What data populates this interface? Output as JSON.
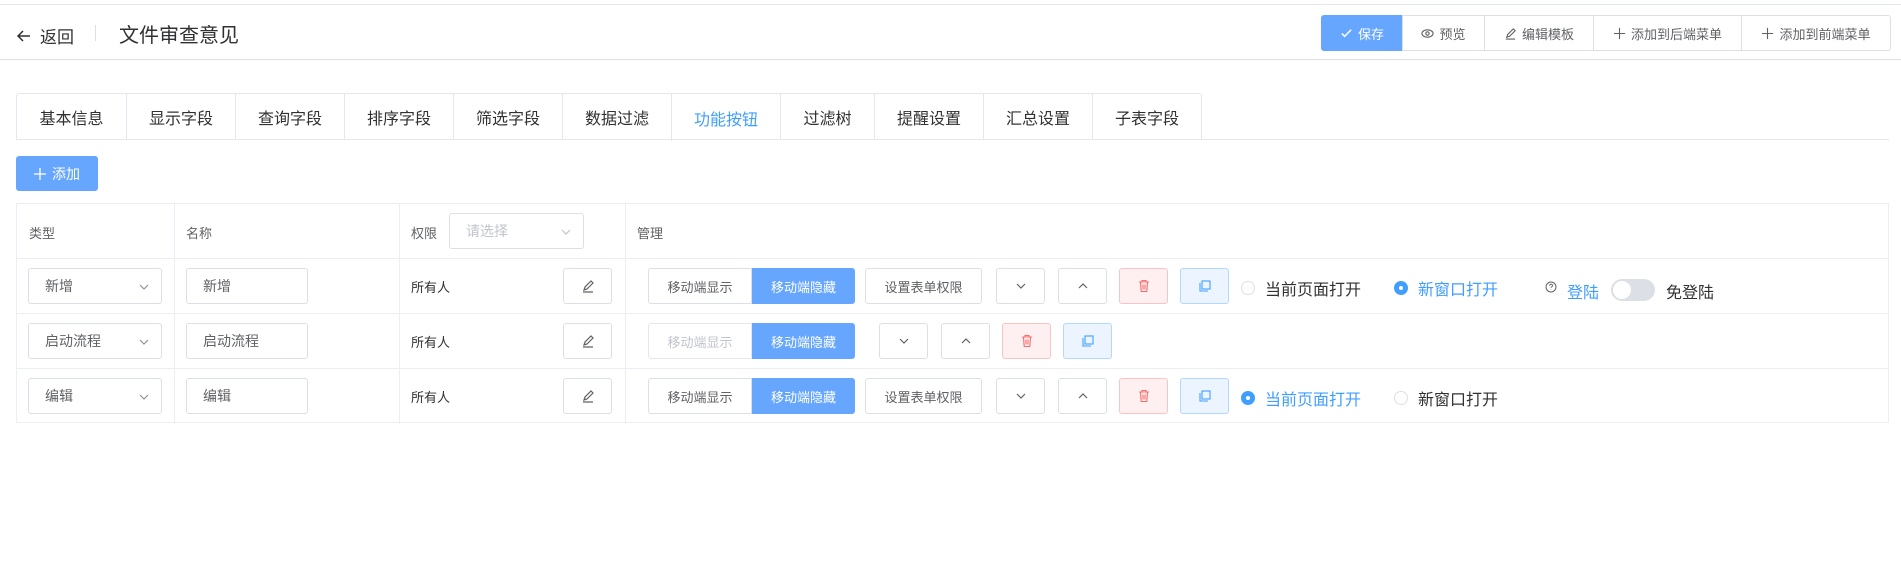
{
  "header": {
    "back_label": "返回",
    "title": "文件审查意见",
    "actions": [
      {
        "label": "保存",
        "icon": "check-icon"
      },
      {
        "label": "预览",
        "icon": "eye-icon"
      },
      {
        "label": "编辑模板",
        "icon": "edit-icon"
      },
      {
        "label": "添加到后端菜单",
        "icon": "plus-icon"
      },
      {
        "label": "添加到前端菜单",
        "icon": "plus-icon"
      }
    ]
  },
  "tabs": [
    "基本信息",
    "显示字段",
    "查询字段",
    "排序字段",
    "筛选字段",
    "数据过滤",
    "功能按钮",
    "过滤树",
    "提醒设置",
    "汇总设置",
    "子表字段"
  ],
  "active_tab": "功能按钮",
  "add_button": "添加",
  "table": {
    "headers": {
      "type": "类型",
      "name": "名称",
      "permission": "权限",
      "permission_placeholder": "请选择",
      "manage": "管理"
    },
    "rows": [
      {
        "type": "新增",
        "name": "新增",
        "permission": "所有人",
        "mobile_show": "移动端显示",
        "mobile_hide": "移动端隐藏",
        "form_perm": "设置表单权限",
        "radio_current": "当前页面打开",
        "radio_new": "新窗口打开",
        "selected_open": "新窗口打开",
        "login_link": "登陆",
        "login_switch_label": "免登陆"
      },
      {
        "type": "启动流程",
        "name": "启动流程",
        "permission": "所有人",
        "mobile_show": "移动端显示",
        "mobile_hide": "移动端隐藏"
      },
      {
        "type": "编辑",
        "name": "编辑",
        "permission": "所有人",
        "mobile_show": "移动端显示",
        "mobile_hide": "移动端隐藏",
        "form_perm": "设置表单权限",
        "radio_current": "当前页面打开",
        "radio_new": "新窗口打开",
        "selected_open": "当前页面打开"
      }
    ]
  },
  "colors": {
    "primary": "#66a6ff",
    "link": "#409eff",
    "danger_bg": "#fef0f0",
    "info_bg": "#ecf5ff"
  }
}
